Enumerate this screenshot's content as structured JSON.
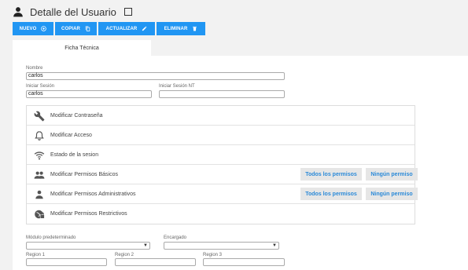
{
  "header": {
    "title": "Detalle del Usuario",
    "icon": "person-icon"
  },
  "toolbar": {
    "color": "#2196f3",
    "buttons": [
      {
        "label": "NUEVO",
        "icon": "add-circle-icon"
      },
      {
        "label": "COPIAR",
        "icon": "copy-icon"
      },
      {
        "label": "ACTUALIZAR",
        "icon": "pencil-icon"
      },
      {
        "label": "ELIMINAR",
        "icon": "trash-icon"
      }
    ]
  },
  "tabs": [
    {
      "label": "Ficha Técnica",
      "active": true
    }
  ],
  "form": {
    "nombre": {
      "label": "Nombre",
      "value": "carlos"
    },
    "iniciar_sesion": {
      "label": "Iniciar Sesión",
      "value": "carlos"
    },
    "iniciar_sesion_nt": {
      "label": "Iniciar Sesión NT",
      "value": ""
    },
    "modulo": {
      "label": "Módulo predeterminado",
      "value": ""
    },
    "encargado": {
      "label": "Encargado",
      "value": ""
    },
    "region1": {
      "label": "Region 1",
      "value": ""
    },
    "region2": {
      "label": "Region 2",
      "value": ""
    },
    "region3": {
      "label": "Region 3",
      "value": ""
    }
  },
  "permissions": [
    {
      "label": "Modificar Contraseña",
      "icon": "wrench-icon"
    },
    {
      "label": "Modificar Acceso",
      "icon": "bell-icon"
    },
    {
      "label": "Estado de la sesion",
      "icon": "wifi-icon"
    },
    {
      "label": "Modificar Permisos Básicos",
      "icon": "people-icon",
      "all": "Todos los permisos",
      "none": "Ningún permiso"
    },
    {
      "label": "Modificar Permisos Administrativos",
      "icon": "person-icon",
      "all": "Todos los permisos",
      "none": "Ningún permiso"
    },
    {
      "label": "Modificar Permisos Restrictivos",
      "icon": "globe-lock-icon"
    }
  ]
}
